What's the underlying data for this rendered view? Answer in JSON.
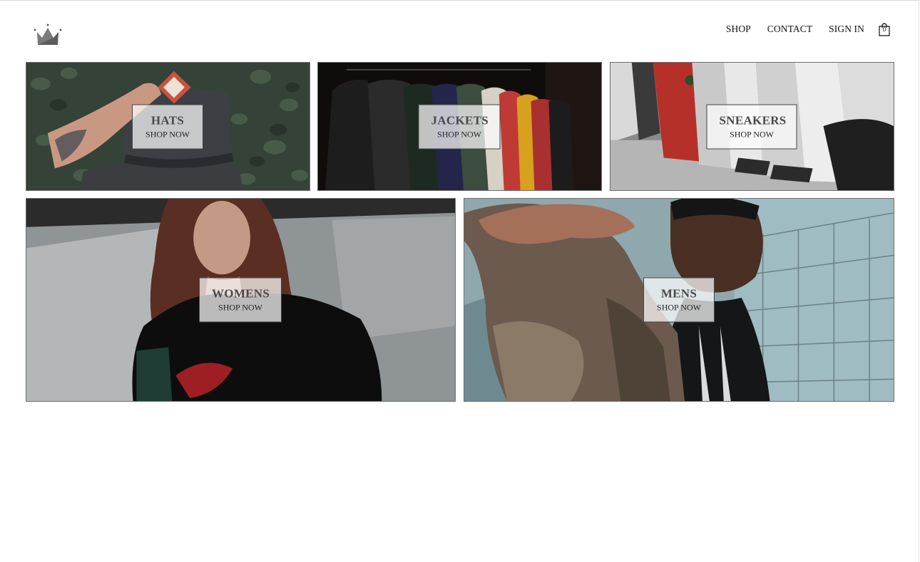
{
  "header": {
    "logo_icon": "crown-icon",
    "nav": [
      {
        "label": "SHOP"
      },
      {
        "label": "CONTACT"
      },
      {
        "label": "SIGN IN"
      }
    ],
    "cart": {
      "icon": "shopping-bag-icon",
      "count": "0"
    }
  },
  "categories": [
    {
      "title": "HATS",
      "cta": "SHOP NOW"
    },
    {
      "title": "JACKETS",
      "cta": "SHOP NOW"
    },
    {
      "title": "SNEAKERS",
      "cta": "SHOP NOW"
    },
    {
      "title": "WOMENS",
      "cta": "SHOP NOW"
    },
    {
      "title": "MENS",
      "cta": "SHOP NOW"
    }
  ]
}
